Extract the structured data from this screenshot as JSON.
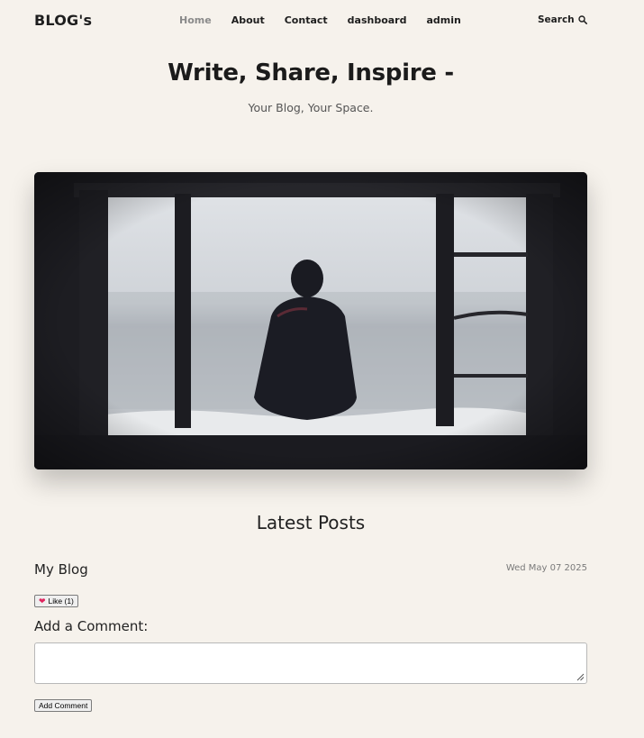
{
  "nav": {
    "logo": "BLOG's",
    "items": [
      {
        "label": "Home"
      },
      {
        "label": "About"
      },
      {
        "label": "Contact"
      },
      {
        "label": "dashboard"
      },
      {
        "label": "admin"
      }
    ],
    "search_label": "Search",
    "search_icon": "search-icon"
  },
  "hero": {
    "title": "Write, Share, Inspire -",
    "subtitle": "Your Blog, Your Space."
  },
  "latest": {
    "heading": "Latest Posts",
    "post": {
      "title": "My Blog",
      "date": "Wed May 07 2025",
      "like_label": "Like (1)",
      "like_icon": "heart-icon"
    }
  },
  "comment": {
    "label": "Add a Comment:",
    "value": "",
    "button": "Add Comment"
  },
  "colors": {
    "background": "#f6f2ec",
    "text": "#1e1e1e",
    "muted_nav": "#8a8a8a",
    "heart": "#e0245e"
  }
}
